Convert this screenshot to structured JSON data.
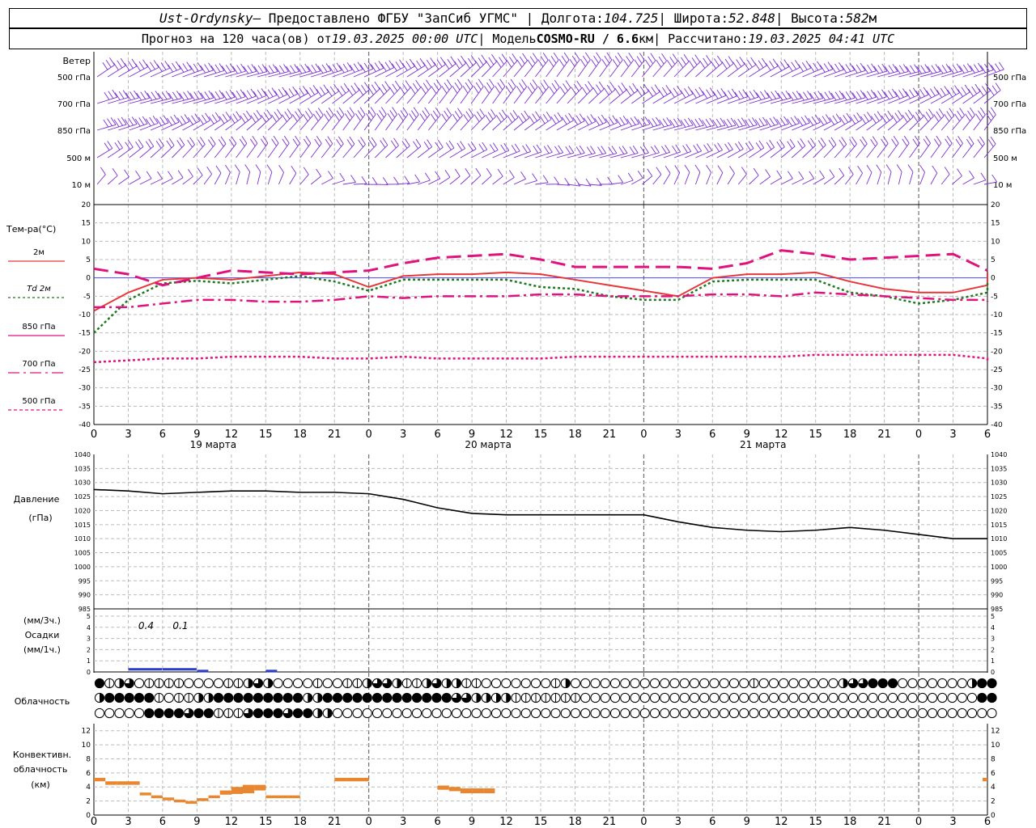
{
  "header": {
    "station": "Ust-Ordynsky",
    "provider": " — Предоставлено ФГБУ \"ЗапСиб УГМС\" | Долгота: ",
    "lon": "104.725",
    "lat_label": " | Широта: ",
    "lat": "52.848",
    "alt_label": " | Высота: ",
    "alt": "582",
    "alt_unit": "м",
    "forecast_prefix": "Прогноз на 120 часа(ов) от ",
    "forecast_start": "19.03.2025 00:00 UTC",
    "model_label": " | Модель ",
    "model": "COSMO-RU / 6.6",
    "model_unit": "км",
    "calc_label": " | Рассчитано: ",
    "calc_time": "19.03.2025 04:41 UTC"
  },
  "wind_panel": {
    "title": "Ветер",
    "levels": [
      "500 гПа",
      "700 гПа",
      "850 гПа",
      "500 м",
      "10  м"
    ],
    "barb_color": "#7b2fd0"
  },
  "chart_data": [
    {
      "type": "line",
      "panel": "temperature",
      "ylabel": "Тем-ра(°C)",
      "ylim": [
        -40,
        20
      ],
      "yticks": [
        20,
        15,
        10,
        5,
        0,
        -5,
        -10,
        -15,
        -20,
        -25,
        -30,
        -35,
        -40
      ],
      "x_hours": [
        0,
        3,
        6,
        9,
        12,
        15,
        18,
        21,
        24,
        27,
        30,
        33,
        36,
        39,
        42,
        45,
        48,
        51,
        54,
        57,
        60,
        63,
        66,
        69,
        72,
        75,
        78
      ],
      "series": [
        {
          "name": "2м",
          "color": "#e8373a",
          "dash": "solid",
          "values": [
            -9,
            -4,
            -0.5,
            0,
            -0.5,
            0.5,
            1.5,
            1,
            -2.5,
            0.5,
            1,
            1,
            1.5,
            1,
            -0.5,
            -2,
            -3.5,
            -5,
            0,
            1,
            1,
            1.5,
            -1,
            -3,
            -4,
            -4,
            -2,
            1.5
          ]
        },
        {
          "name": "Td  2м",
          "color": "#1f7a1f",
          "dash": "dots",
          "values": [
            -15,
            -6,
            -1.5,
            -0.8,
            -1.5,
            -0.5,
            0.5,
            -1,
            -3.5,
            -0.5,
            -0.5,
            -0.5,
            -0.5,
            -2.5,
            -3,
            -5,
            -6,
            -6,
            -1,
            -0.5,
            -0.5,
            -0.5,
            -4,
            -5,
            -7,
            -6,
            -4,
            -1
          ]
        },
        {
          "name": "850 гПа",
          "color": "#e0127e",
          "dash": "long",
          "values": [
            2.5,
            1,
            -2,
            0,
            2,
            1.5,
            1,
            1.5,
            2,
            4,
            5.5,
            6,
            6.5,
            5,
            3,
            3,
            3,
            3,
            2.5,
            4,
            7.5,
            6.5,
            5,
            5.5,
            6,
            6.5,
            2
          ]
        },
        {
          "name": "700 гПа",
          "color": "#e0127e",
          "dash": "dashdot",
          "values": [
            -8,
            -8,
            -7,
            -6,
            -6,
            -6.5,
            -6.5,
            -6,
            -5,
            -5.5,
            -5,
            -5,
            -5,
            -4.5,
            -4.5,
            -5,
            -5,
            -5,
            -4.5,
            -4.5,
            -5,
            -4,
            -4.5,
            -5,
            -5.5,
            -6,
            -6,
            -6.5
          ]
        },
        {
          "name": "500 гПа",
          "color": "#e0127e",
          "dash": "dots",
          "values": [
            -23,
            -22.5,
            -22,
            -22,
            -21.5,
            -21.5,
            -21.5,
            -22,
            -22,
            -21.5,
            -22,
            -22,
            -22,
            -22,
            -21.5,
            -21.5,
            -21.5,
            -21.5,
            -21.5,
            -21.5,
            -21.5,
            -21,
            -21,
            -21,
            -21,
            -21,
            -22,
            -22.5
          ]
        }
      ]
    },
    {
      "type": "line",
      "panel": "pressure",
      "ylabel": "Давление",
      "yunit": "(гПа)",
      "ylim": [
        985,
        1040
      ],
      "yticks": [
        1040,
        1035,
        1030,
        1025,
        1020,
        1015,
        1010,
        1005,
        1000,
        995,
        990,
        985
      ],
      "x_hours": [
        0,
        3,
        6,
        9,
        12,
        15,
        18,
        21,
        24,
        27,
        30,
        33,
        36,
        39,
        42,
        45,
        48,
        51,
        54,
        57,
        60,
        63,
        66,
        69,
        72,
        75,
        78
      ],
      "series": [
        {
          "name": "",
          "color": "#000000",
          "values": [
            1027.5,
            1027,
            1026,
            1026.5,
            1027,
            1027,
            1026.5,
            1026.5,
            1026,
            1024,
            1021,
            1019,
            1018.5,
            1018.5,
            1018.5,
            1018.5,
            1018.5,
            1016,
            1014,
            1013,
            1012.5,
            1013,
            1014,
            1013,
            1011.5,
            1010,
            1010
          ]
        }
      ]
    },
    {
      "type": "bar",
      "panel": "precipitation",
      "ylabel": "Осадки",
      "yunit_top": "(мм/3ч.)",
      "yunit_bottom": "(мм/1ч.)",
      "ylim": [
        0,
        5
      ],
      "yticks": [
        5,
        4,
        3,
        2,
        1,
        0
      ],
      "annotations": [
        "0.4",
        "0.1"
      ],
      "bars_hours": [
        3,
        6,
        9,
        15
      ],
      "bars_values": [
        0.2,
        0.2,
        0.05,
        0.05
      ]
    },
    {
      "type": "bar",
      "panel": "convective_cloud",
      "ylabel": "Конвективн. облачность",
      "yunit": "(км)",
      "ylim": [
        0,
        13
      ],
      "yticks": [
        12,
        10,
        8,
        6,
        4,
        2,
        0
      ],
      "color": "#e8872f",
      "hours": [
        0,
        1,
        2,
        3,
        4,
        5,
        6,
        7,
        8,
        9,
        10,
        11,
        12,
        13,
        14,
        15,
        16,
        17,
        21,
        22,
        23,
        30,
        31,
        32,
        33,
        34,
        78
      ],
      "tops": [
        5.3,
        4.8,
        4.8,
        4.8,
        3.2,
        2.8,
        2.5,
        2.2,
        2.0,
        2.4,
        2.8,
        3.5,
        4.0,
        4.3,
        4.3,
        2.8,
        2.8,
        2.8,
        5.3,
        5.3,
        5.3,
        4.2,
        4.0,
        3.8,
        3.8,
        3.8,
        5.3
      ],
      "bottoms": [
        4.8,
        4.3,
        4.3,
        4.3,
        2.8,
        2.4,
        2.1,
        1.8,
        1.6,
        2.0,
        2.4,
        2.9,
        3.0,
        3.1,
        3.5,
        2.4,
        2.4,
        2.4,
        4.8,
        4.8,
        4.8,
        3.6,
        3.4,
        3.1,
        3.1,
        3.1,
        4.8
      ]
    }
  ],
  "cloud_panel": {
    "title": "Облачность",
    "rows": [
      [
        4,
        1,
        2,
        3,
        0,
        1,
        1,
        1,
        1,
        0,
        0,
        0,
        0,
        1,
        1,
        2,
        3,
        2,
        0,
        0,
        0,
        0,
        1,
        0,
        0,
        1,
        1,
        2,
        3,
        3,
        2,
        1,
        1,
        2,
        3,
        2,
        2,
        1,
        1,
        0,
        0,
        0,
        0,
        0,
        0,
        0,
        1,
        2,
        0,
        0,
        0,
        0,
        0,
        0,
        0,
        0,
        0,
        0,
        0,
        0,
        0,
        0,
        0,
        0,
        0,
        0,
        1,
        0,
        0,
        0,
        0,
        0,
        0,
        0,
        0,
        2,
        3,
        3,
        4,
        4,
        4,
        0,
        0,
        0,
        0,
        0,
        0,
        0,
        2,
        4,
        4
      ],
      [
        2,
        4,
        4,
        4,
        4,
        4,
        1,
        0,
        1,
        1,
        2,
        2,
        4,
        4,
        4,
        4,
        4,
        4,
        4,
        4,
        4,
        2,
        2,
        4,
        4,
        4,
        4,
        4,
        4,
        4,
        4,
        4,
        4,
        4,
        4,
        4,
        3,
        3,
        2,
        2,
        2,
        2,
        1,
        1,
        1,
        1,
        1,
        1,
        1,
        0,
        0,
        0,
        0,
        0,
        0,
        0,
        0,
        0,
        0,
        0,
        0,
        0,
        0,
        0,
        0,
        0,
        0,
        0,
        0,
        0,
        0,
        0,
        0,
        0,
        0,
        0,
        0,
        0,
        0,
        0,
        0,
        0,
        0,
        0,
        0,
        0,
        0,
        0,
        0,
        4,
        4
      ],
      [
        0,
        0,
        0,
        0,
        0,
        4,
        4,
        4,
        4,
        3,
        4,
        4,
        1,
        1,
        1,
        3,
        4,
        4,
        4,
        3,
        4,
        4,
        2,
        2,
        0,
        0,
        0,
        0,
        0,
        0,
        0,
        0,
        0,
        0,
        0,
        0,
        0,
        0,
        0,
        0,
        0,
        0,
        0,
        0,
        0,
        0,
        0,
        0,
        0,
        0,
        0,
        0,
        0,
        0,
        0,
        0,
        0,
        0,
        0,
        0,
        0,
        0,
        0,
        0,
        0,
        0,
        0,
        0,
        0,
        0,
        0,
        0,
        0,
        0,
        0,
        0,
        0,
        0,
        0,
        0,
        0,
        0,
        0,
        0,
        0,
        0,
        0,
        0,
        0,
        0,
        0
      ]
    ]
  },
  "x_axis": {
    "tick_labels": [
      "0",
      "3",
      "6",
      "9",
      "12",
      "15",
      "18",
      "21",
      "0",
      "3",
      "6",
      "9",
      "12",
      "15",
      "18",
      "21",
      "0",
      "3",
      "6",
      "9",
      "12",
      "15",
      "18",
      "21",
      "0",
      "3",
      "6"
    ],
    "days": [
      "19 марта",
      "20 марта",
      "21 марта"
    ]
  },
  "legend": {
    "temp_2m": "2м",
    "td_label": "Td",
    "td_unit": "2м",
    "l850": "850 гПа",
    "l700": "700 гПа",
    "l500": "500 гПа"
  }
}
